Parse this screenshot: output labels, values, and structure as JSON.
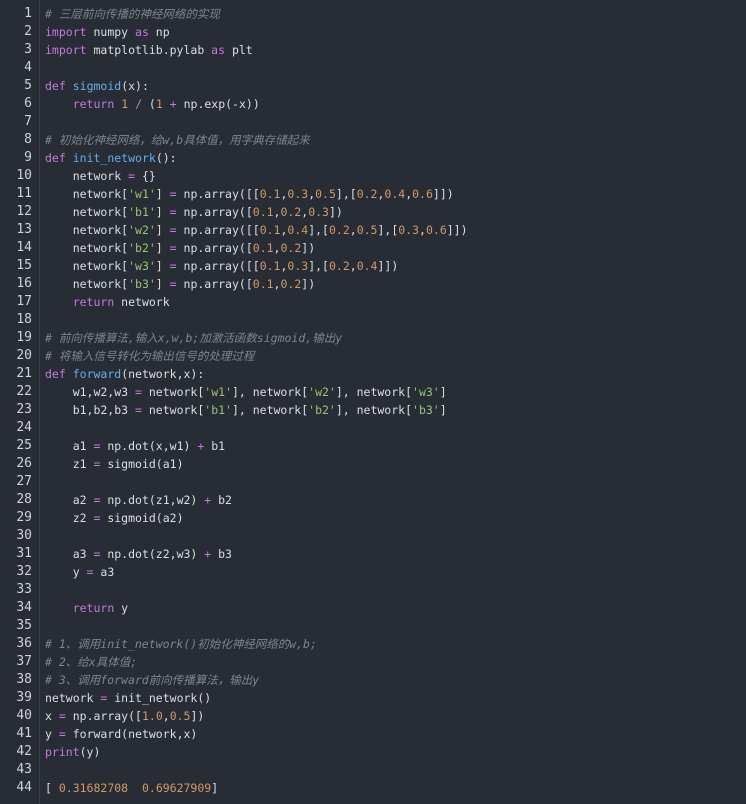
{
  "colors": {
    "background": "#282c34",
    "keyword": "#c678dd",
    "function": "#61afef",
    "number": "#d19a66",
    "string": "#98c379",
    "comment": "#7f848e",
    "plain": "#dcdfe4"
  },
  "lines": [
    {
      "n": "1",
      "t": [
        [
          "cm",
          "# 三层前向传播的神经网络的实现"
        ]
      ]
    },
    {
      "n": "2",
      "t": [
        [
          "kw",
          "import"
        ],
        [
          "pl",
          " numpy "
        ],
        [
          "kw",
          "as"
        ],
        [
          "pl",
          " np"
        ]
      ]
    },
    {
      "n": "3",
      "t": [
        [
          "kw",
          "import"
        ],
        [
          "pl",
          " matplotlib.pylab "
        ],
        [
          "kw",
          "as"
        ],
        [
          "pl",
          " plt"
        ]
      ]
    },
    {
      "n": "4",
      "t": []
    },
    {
      "n": "5",
      "t": [
        [
          "kw",
          "def"
        ],
        [
          "pl",
          " "
        ],
        [
          "fn",
          "sigmoid"
        ],
        [
          "pl",
          "(x):"
        ]
      ]
    },
    {
      "n": "6",
      "t": [
        [
          "pl",
          "    "
        ],
        [
          "kw",
          "return"
        ],
        [
          "pl",
          " "
        ],
        [
          "num",
          "1"
        ],
        [
          "pl",
          " "
        ],
        [
          "op",
          "/"
        ],
        [
          "pl",
          " ("
        ],
        [
          "num",
          "1"
        ],
        [
          "pl",
          " "
        ],
        [
          "op",
          "+"
        ],
        [
          "pl",
          " np.exp(-x))"
        ]
      ]
    },
    {
      "n": "7",
      "t": []
    },
    {
      "n": "8",
      "t": [
        [
          "cm",
          "# 初始化神经网络，给w,b具体值，用字典存储起来"
        ]
      ]
    },
    {
      "n": "9",
      "t": [
        [
          "kw",
          "def"
        ],
        [
          "pl",
          " "
        ],
        [
          "fn",
          "init_network"
        ],
        [
          "pl",
          "():"
        ]
      ]
    },
    {
      "n": "10",
      "t": [
        [
          "pl",
          "    network "
        ],
        [
          "op",
          "="
        ],
        [
          "pl",
          " {}"
        ]
      ]
    },
    {
      "n": "11",
      "t": [
        [
          "pl",
          "    network["
        ],
        [
          "str",
          "'w1'"
        ],
        [
          "pl",
          "] "
        ],
        [
          "op",
          "="
        ],
        [
          "pl",
          " np.array([["
        ],
        [
          "num",
          "0.1"
        ],
        [
          "pl",
          ","
        ],
        [
          "num",
          "0.3"
        ],
        [
          "pl",
          ","
        ],
        [
          "num",
          "0.5"
        ],
        [
          "pl",
          "],["
        ],
        [
          "num",
          "0.2"
        ],
        [
          "pl",
          ","
        ],
        [
          "num",
          "0.4"
        ],
        [
          "pl",
          ","
        ],
        [
          "num",
          "0.6"
        ],
        [
          "pl",
          "]])"
        ]
      ]
    },
    {
      "n": "12",
      "t": [
        [
          "pl",
          "    network["
        ],
        [
          "str",
          "'b1'"
        ],
        [
          "pl",
          "] "
        ],
        [
          "op",
          "="
        ],
        [
          "pl",
          " np.array(["
        ],
        [
          "num",
          "0.1"
        ],
        [
          "pl",
          ","
        ],
        [
          "num",
          "0.2"
        ],
        [
          "pl",
          ","
        ],
        [
          "num",
          "0.3"
        ],
        [
          "pl",
          "])"
        ]
      ]
    },
    {
      "n": "13",
      "t": [
        [
          "pl",
          "    network["
        ],
        [
          "str",
          "'w2'"
        ],
        [
          "pl",
          "] "
        ],
        [
          "op",
          "="
        ],
        [
          "pl",
          " np.array([["
        ],
        [
          "num",
          "0.1"
        ],
        [
          "pl",
          ","
        ],
        [
          "num",
          "0.4"
        ],
        [
          "pl",
          "],["
        ],
        [
          "num",
          "0.2"
        ],
        [
          "pl",
          ","
        ],
        [
          "num",
          "0.5"
        ],
        [
          "pl",
          "],["
        ],
        [
          "num",
          "0.3"
        ],
        [
          "pl",
          ","
        ],
        [
          "num",
          "0.6"
        ],
        [
          "pl",
          "]])"
        ]
      ]
    },
    {
      "n": "14",
      "t": [
        [
          "pl",
          "    network["
        ],
        [
          "str",
          "'b2'"
        ],
        [
          "pl",
          "] "
        ],
        [
          "op",
          "="
        ],
        [
          "pl",
          " np.array(["
        ],
        [
          "num",
          "0.1"
        ],
        [
          "pl",
          ","
        ],
        [
          "num",
          "0.2"
        ],
        [
          "pl",
          "])"
        ]
      ]
    },
    {
      "n": "15",
      "t": [
        [
          "pl",
          "    network["
        ],
        [
          "str",
          "'w3'"
        ],
        [
          "pl",
          "] "
        ],
        [
          "op",
          "="
        ],
        [
          "pl",
          " np.array([["
        ],
        [
          "num",
          "0.1"
        ],
        [
          "pl",
          ","
        ],
        [
          "num",
          "0.3"
        ],
        [
          "pl",
          "],["
        ],
        [
          "num",
          "0.2"
        ],
        [
          "pl",
          ","
        ],
        [
          "num",
          "0.4"
        ],
        [
          "pl",
          "]])"
        ]
      ]
    },
    {
      "n": "16",
      "t": [
        [
          "pl",
          "    network["
        ],
        [
          "str",
          "'b3'"
        ],
        [
          "pl",
          "] "
        ],
        [
          "op",
          "="
        ],
        [
          "pl",
          " np.array(["
        ],
        [
          "num",
          "0.1"
        ],
        [
          "pl",
          ","
        ],
        [
          "num",
          "0.2"
        ],
        [
          "pl",
          "])"
        ]
      ]
    },
    {
      "n": "17",
      "t": [
        [
          "pl",
          "    "
        ],
        [
          "kw",
          "return"
        ],
        [
          "pl",
          " network"
        ]
      ]
    },
    {
      "n": "18",
      "t": []
    },
    {
      "n": "19",
      "t": [
        [
          "cm",
          "# 前向传播算法,输入x,w,b;加激活函数sigmoid,输出y"
        ]
      ]
    },
    {
      "n": "20",
      "t": [
        [
          "cm",
          "# 将输入信号转化为输出信号的处理过程"
        ]
      ]
    },
    {
      "n": "21",
      "t": [
        [
          "kw",
          "def"
        ],
        [
          "pl",
          " "
        ],
        [
          "fn",
          "forward"
        ],
        [
          "pl",
          "(network,x):"
        ]
      ]
    },
    {
      "n": "22",
      "t": [
        [
          "pl",
          "    w1,w2,w3 "
        ],
        [
          "op",
          "="
        ],
        [
          "pl",
          " network["
        ],
        [
          "str",
          "'w1'"
        ],
        [
          "pl",
          "], network["
        ],
        [
          "str",
          "'w2'"
        ],
        [
          "pl",
          "], network["
        ],
        [
          "str",
          "'w3'"
        ],
        [
          "pl",
          "]"
        ]
      ]
    },
    {
      "n": "23",
      "t": [
        [
          "pl",
          "    b1,b2,b3 "
        ],
        [
          "op",
          "="
        ],
        [
          "pl",
          " network["
        ],
        [
          "str",
          "'b1'"
        ],
        [
          "pl",
          "], network["
        ],
        [
          "str",
          "'b2'"
        ],
        [
          "pl",
          "], network["
        ],
        [
          "str",
          "'b3'"
        ],
        [
          "pl",
          "]"
        ]
      ]
    },
    {
      "n": "24",
      "t": []
    },
    {
      "n": "25",
      "t": [
        [
          "pl",
          "    a1 "
        ],
        [
          "op",
          "="
        ],
        [
          "pl",
          " np.dot(x,w1) "
        ],
        [
          "op",
          "+"
        ],
        [
          "pl",
          " b1"
        ]
      ]
    },
    {
      "n": "26",
      "t": [
        [
          "pl",
          "    z1 "
        ],
        [
          "op",
          "="
        ],
        [
          "pl",
          " sigmoid(a1)"
        ]
      ]
    },
    {
      "n": "27",
      "t": []
    },
    {
      "n": "28",
      "t": [
        [
          "pl",
          "    a2 "
        ],
        [
          "op",
          "="
        ],
        [
          "pl",
          " np.dot(z1,w2) "
        ],
        [
          "op",
          "+"
        ],
        [
          "pl",
          " b2"
        ]
      ]
    },
    {
      "n": "29",
      "t": [
        [
          "pl",
          "    z2 "
        ],
        [
          "op",
          "="
        ],
        [
          "pl",
          " sigmoid(a2)"
        ]
      ]
    },
    {
      "n": "30",
      "t": []
    },
    {
      "n": "31",
      "t": [
        [
          "pl",
          "    a3 "
        ],
        [
          "op",
          "="
        ],
        [
          "pl",
          " np.dot(z2,w3) "
        ],
        [
          "op",
          "+"
        ],
        [
          "pl",
          " b3"
        ]
      ]
    },
    {
      "n": "32",
      "t": [
        [
          "pl",
          "    y "
        ],
        [
          "op",
          "="
        ],
        [
          "pl",
          " a3"
        ]
      ]
    },
    {
      "n": "33",
      "t": []
    },
    {
      "n": "34",
      "t": [
        [
          "pl",
          "    "
        ],
        [
          "kw",
          "return"
        ],
        [
          "pl",
          " y"
        ]
      ]
    },
    {
      "n": "35",
      "t": []
    },
    {
      "n": "36",
      "t": [
        [
          "cm",
          "# 1、调用init_network()初始化神经网络的w,b;"
        ]
      ]
    },
    {
      "n": "37",
      "t": [
        [
          "cm",
          "# 2、给x具体值;"
        ]
      ]
    },
    {
      "n": "38",
      "t": [
        [
          "cm",
          "# 3、调用forward前向传播算法，输出y"
        ]
      ]
    },
    {
      "n": "39",
      "t": [
        [
          "pl",
          "network "
        ],
        [
          "op",
          "="
        ],
        [
          "pl",
          " init_network()"
        ]
      ]
    },
    {
      "n": "40",
      "t": [
        [
          "pl",
          "x "
        ],
        [
          "op",
          "="
        ],
        [
          "pl",
          " np.array(["
        ],
        [
          "num",
          "1.0"
        ],
        [
          "pl",
          ","
        ],
        [
          "num",
          "0.5"
        ],
        [
          "pl",
          "])"
        ]
      ]
    },
    {
      "n": "41",
      "t": [
        [
          "pl",
          "y "
        ],
        [
          "op",
          "="
        ],
        [
          "pl",
          " forward(network,x)"
        ]
      ]
    },
    {
      "n": "42",
      "t": [
        [
          "kw",
          "print"
        ],
        [
          "pl",
          "(y)"
        ]
      ]
    },
    {
      "n": "43",
      "t": []
    },
    {
      "n": "44",
      "t": [
        [
          "pl",
          "[ "
        ],
        [
          "num",
          "0.31682708"
        ],
        [
          "pl",
          "  "
        ],
        [
          "num",
          "0.69627909"
        ],
        [
          "pl",
          "]"
        ]
      ]
    }
  ]
}
